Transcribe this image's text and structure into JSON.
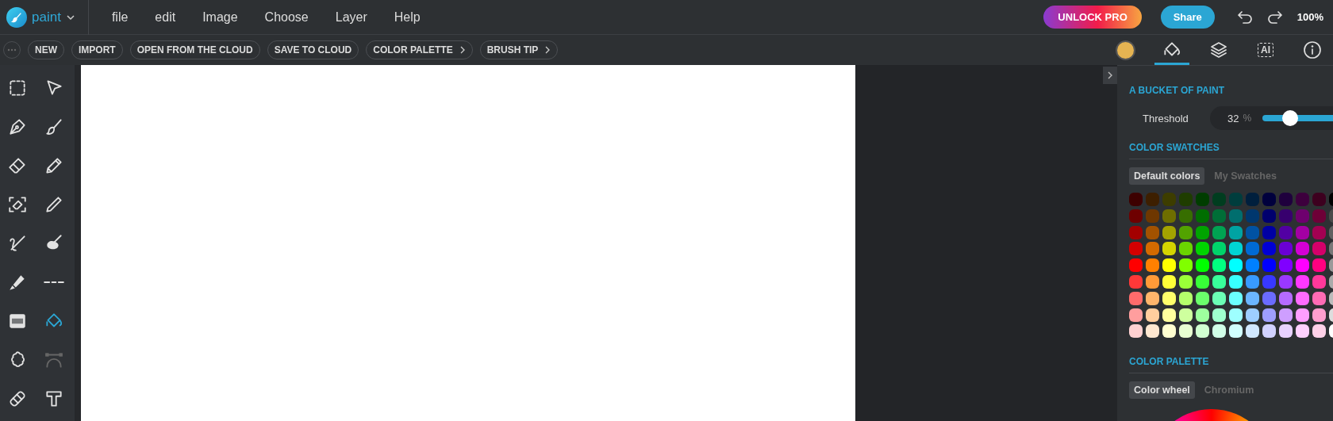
{
  "app": {
    "name": "paint"
  },
  "menu": [
    "file",
    "edit",
    "Image",
    "Choose",
    "Layer",
    "Help"
  ],
  "top_actions": {
    "unlock": "UNLOCK PRO",
    "share": "Share",
    "zoom": "100%"
  },
  "actions": [
    {
      "label": "NEW",
      "has_caret": false
    },
    {
      "label": "IMPORT",
      "has_caret": false
    },
    {
      "label": "OPEN FROM THE CLOUD",
      "has_caret": false
    },
    {
      "label": "SAVE TO CLOUD",
      "has_caret": false
    },
    {
      "label": "COLOR PALETTE",
      "has_caret": true
    },
    {
      "label": "BRUSH TIP",
      "has_caret": true
    }
  ],
  "panel_tabs": [
    {
      "kind": "color",
      "color": "#e6b452",
      "selected": false
    },
    {
      "kind": "bucket",
      "selected": true
    },
    {
      "kind": "layers",
      "selected": false
    },
    {
      "kind": "ai",
      "label": "AI",
      "selected": false
    },
    {
      "kind": "info",
      "selected": false
    }
  ],
  "tools": [
    {
      "kind": "marquee",
      "selected": false,
      "disabled": false
    },
    {
      "kind": "pointer",
      "selected": false,
      "disabled": false
    },
    {
      "kind": "pen",
      "selected": false,
      "disabled": false
    },
    {
      "kind": "brush",
      "selected": false,
      "disabled": false
    },
    {
      "kind": "eraser",
      "selected": false,
      "disabled": false
    },
    {
      "kind": "pencil",
      "selected": false,
      "disabled": false
    },
    {
      "kind": "smarteraser",
      "selected": false,
      "disabled": false
    },
    {
      "kind": "thinpencil",
      "selected": false,
      "disabled": false
    },
    {
      "kind": "scribble",
      "selected": false,
      "disabled": false
    },
    {
      "kind": "smudge",
      "selected": false,
      "disabled": false
    },
    {
      "kind": "highlighter",
      "selected": false,
      "disabled": false
    },
    {
      "kind": "dashes",
      "selected": false,
      "disabled": false
    },
    {
      "kind": "pattern",
      "selected": false,
      "disabled": false
    },
    {
      "kind": "bucket",
      "selected": true,
      "disabled": false
    },
    {
      "kind": "shape",
      "selected": false,
      "disabled": false
    },
    {
      "kind": "bezier",
      "selected": false,
      "disabled": true
    },
    {
      "kind": "tape",
      "selected": false,
      "disabled": false
    },
    {
      "kind": "text",
      "selected": false,
      "disabled": false
    }
  ],
  "panel": {
    "section_title": "A BUCKET OF PAINT",
    "threshold": {
      "label": "Threshold",
      "value": "32",
      "unit": "%",
      "level": 0.32
    },
    "swatches": {
      "title": "COLOR SWATCHES",
      "tabs": [
        {
          "label": "Default colors",
          "selected": true
        },
        {
          "label": "My Swatches",
          "selected": false
        }
      ],
      "rows": [
        {
          "swatches": [
            {
              "color": "#3d0000"
            },
            {
              "color": "#3d1f00"
            },
            {
              "color": "#3d3d00"
            },
            {
              "color": "#1f3d00"
            },
            {
              "color": "#003d00"
            },
            {
              "color": "#003d1f"
            },
            {
              "color": "#003d3d"
            },
            {
              "color": "#001f3d"
            },
            {
              "color": "#00003d"
            },
            {
              "color": "#1f003d"
            },
            {
              "color": "#3d003d"
            },
            {
              "color": "#3d001f"
            },
            {
              "color": "#000000"
            }
          ]
        },
        {
          "swatches": [
            {
              "color": "#6e0000"
            },
            {
              "color": "#6e3700"
            },
            {
              "color": "#6e6e00"
            },
            {
              "color": "#376e00"
            },
            {
              "color": "#006e00"
            },
            {
              "color": "#006e37"
            },
            {
              "color": "#006e6e"
            },
            {
              "color": "#00376e"
            },
            {
              "color": "#00006e"
            },
            {
              "color": "#37006e"
            },
            {
              "color": "#6e006e"
            },
            {
              "color": "#6e0037"
            },
            {
              "color": "#4a4a4a"
            }
          ]
        },
        {
          "swatches": [
            {
              "color": "#a30000"
            },
            {
              "color": "#a35200"
            },
            {
              "color": "#a3a300"
            },
            {
              "color": "#52a300"
            },
            {
              "color": "#00a300"
            },
            {
              "color": "#00a352"
            },
            {
              "color": "#00a3a3"
            },
            {
              "color": "#0052a3"
            },
            {
              "color": "#0000a3"
            },
            {
              "color": "#5200a3"
            },
            {
              "color": "#a300a3"
            },
            {
              "color": "#a30052"
            },
            {
              "color": "#606060"
            }
          ]
        },
        {
          "swatches": [
            {
              "color": "#d40000"
            },
            {
              "color": "#d46a00"
            },
            {
              "color": "#d4d400"
            },
            {
              "color": "#6ad400"
            },
            {
              "color": "#00d400"
            },
            {
              "color": "#00d46a"
            },
            {
              "color": "#00d4d4"
            },
            {
              "color": "#006ad4"
            },
            {
              "color": "#0000d4"
            },
            {
              "color": "#6a00d4"
            },
            {
              "color": "#d400d4"
            },
            {
              "color": "#d4006a"
            },
            {
              "color": "#777777"
            }
          ]
        },
        {
          "swatches": [
            {
              "color": "#ff0000"
            },
            {
              "color": "#ff8000"
            },
            {
              "color": "#ffff00"
            },
            {
              "color": "#80ff00"
            },
            {
              "color": "#00ff00"
            },
            {
              "color": "#00ff80"
            },
            {
              "color": "#00ffff"
            },
            {
              "color": "#0080ff"
            },
            {
              "color": "#0000ff"
            },
            {
              "color": "#8000ff"
            },
            {
              "color": "#ff00ff"
            },
            {
              "color": "#ff0080"
            },
            {
              "color": "#999999"
            }
          ]
        },
        {
          "swatches": [
            {
              "color": "#ff3838"
            },
            {
              "color": "#ff9a38"
            },
            {
              "color": "#ffff38"
            },
            {
              "color": "#9aff38"
            },
            {
              "color": "#38ff38"
            },
            {
              "color": "#38ff9a"
            },
            {
              "color": "#38ffff"
            },
            {
              "color": "#389aff"
            },
            {
              "color": "#3838ff"
            },
            {
              "color": "#9a38ff"
            },
            {
              "color": "#ff38ff"
            },
            {
              "color": "#ff389a"
            },
            {
              "color": "#aaaaaa"
            }
          ]
        },
        {
          "swatches": [
            {
              "color": "#ff6b6b"
            },
            {
              "color": "#ffb56b"
            },
            {
              "color": "#ffff6b"
            },
            {
              "color": "#b5ff6b"
            },
            {
              "color": "#6bff6b"
            },
            {
              "color": "#6bffb5"
            },
            {
              "color": "#6bffff"
            },
            {
              "color": "#6bb5ff"
            },
            {
              "color": "#6b6bff"
            },
            {
              "color": "#b56bff"
            },
            {
              "color": "#ff6bff"
            },
            {
              "color": "#ff6bb5"
            },
            {
              "color": "#bbbbbb"
            }
          ]
        },
        {
          "swatches": [
            {
              "color": "#ff9e9e"
            },
            {
              "color": "#ffce9e"
            },
            {
              "color": "#ffff9e"
            },
            {
              "color": "#ceff9e"
            },
            {
              "color": "#9eff9e"
            },
            {
              "color": "#9effce"
            },
            {
              "color": "#9effff"
            },
            {
              "color": "#9eceff"
            },
            {
              "color": "#9e9eff"
            },
            {
              "color": "#ce9eff"
            },
            {
              "color": "#ff9eff"
            },
            {
              "color": "#ff9ece"
            },
            {
              "color": "#dddddd"
            }
          ]
        },
        {
          "swatches": [
            {
              "color": "#ffd1d1"
            },
            {
              "color": "#ffe8d1"
            },
            {
              "color": "#ffffd1"
            },
            {
              "color": "#e8ffd1"
            },
            {
              "color": "#d1ffd1"
            },
            {
              "color": "#d1ffe8"
            },
            {
              "color": "#d1ffff"
            },
            {
              "color": "#d1e8ff"
            },
            {
              "color": "#d1d1ff"
            },
            {
              "color": "#e8d1ff"
            },
            {
              "color": "#ffd1ff"
            },
            {
              "color": "#ffd1e8"
            },
            {
              "color": "#ffffff"
            }
          ]
        }
      ]
    },
    "palette": {
      "title": "COLOR PALETTE",
      "tabs": [
        {
          "label": "Color wheel",
          "selected": true
        },
        {
          "label": "Chromium",
          "selected": false
        }
      ]
    }
  }
}
